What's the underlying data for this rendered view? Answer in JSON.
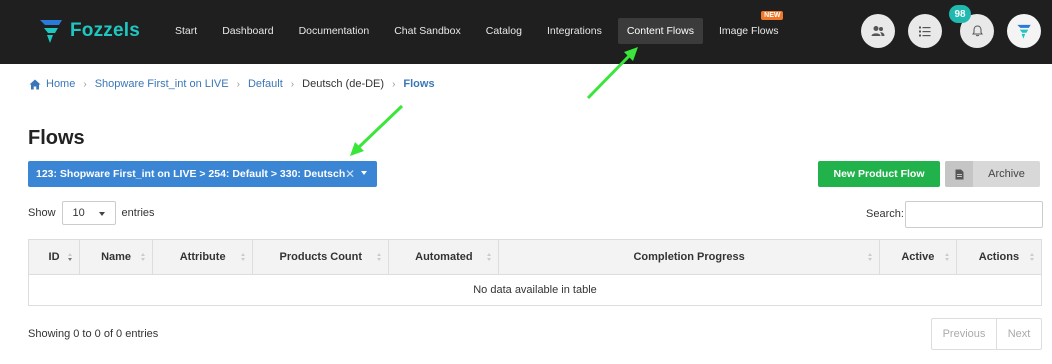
{
  "brand": {
    "name": "Fozzels",
    "accent": "#1fc7c0"
  },
  "nav": [
    {
      "label": "Start",
      "active": false
    },
    {
      "label": "Dashboard",
      "active": false
    },
    {
      "label": "Documentation",
      "active": false
    },
    {
      "label": "Chat Sandbox",
      "active": false
    },
    {
      "label": "Catalog",
      "active": false
    },
    {
      "label": "Integrations",
      "active": false
    },
    {
      "label": "Content Flows",
      "active": true
    },
    {
      "label": "Image Flows",
      "active": false,
      "badge": "NEW"
    }
  ],
  "header_icons": {
    "users": "users-icon",
    "tasks": "tasks-icon",
    "notifications": "bell-icon",
    "notification_count": "98",
    "avatar": "fozzels-avatar"
  },
  "breadcrumb": {
    "home": "Home",
    "items": [
      "Shopware First_int on LIVE",
      "Default",
      "Deutsch (de-DE)",
      "Flows"
    ]
  },
  "page": {
    "title": "Flows",
    "selector_label": "123: Shopware First_int on LIVE > 254: Default > 330: Deutsch",
    "new_button": "New Product Flow",
    "archive_button": "Archive"
  },
  "table_controls": {
    "show_label": "Show",
    "page_length": "10",
    "entries_label": "entries",
    "search_label": "Search:",
    "search_value": ""
  },
  "table": {
    "columns": [
      "ID",
      "Name",
      "Attribute",
      "Products Count",
      "Automated",
      "Completion Progress",
      "Active",
      "Actions"
    ],
    "empty_message": "No data available in table"
  },
  "footer": {
    "info": "Showing 0 to 0 of 0 entries",
    "prev": "Previous",
    "next": "Next"
  },
  "colors": {
    "topbar": "#1f1f1f",
    "primary": "#3a86d4",
    "success": "#22b24b",
    "annotation_arrow": "#39e639",
    "new_badge": "#f0782a",
    "count_badge": "#1fb9b0"
  }
}
